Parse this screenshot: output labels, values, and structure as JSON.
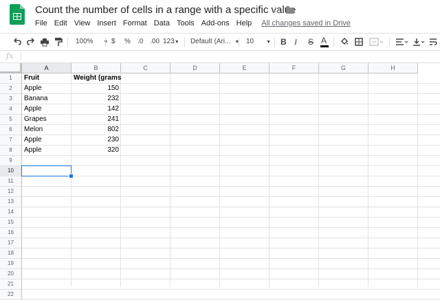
{
  "doc": {
    "title": "Count the number of cells in a range with a specific value",
    "saved_status": "All changes saved in Drive"
  },
  "menu": [
    "File",
    "Edit",
    "View",
    "Insert",
    "Format",
    "Data",
    "Tools",
    "Add-ons",
    "Help"
  ],
  "toolbar": {
    "zoom": "100%",
    "currency": "$",
    "percent": "%",
    "dec_decrease": ".0",
    "dec_increase": ".00",
    "more_formats": "123",
    "font": "Default (Ari...",
    "font_size": "10",
    "bold": "B",
    "italic": "I",
    "strike": "S",
    "text_color": "A"
  },
  "formula_bar": {
    "fx": "fx",
    "value": ""
  },
  "columns": [
    "A",
    "B",
    "C",
    "D",
    "E",
    "F",
    "G",
    "H"
  ],
  "rows": [
    "1",
    "2",
    "3",
    "4",
    "5",
    "6",
    "7",
    "8",
    "9",
    "10",
    "11",
    "12",
    "13",
    "14",
    "15",
    "16",
    "17",
    "18",
    "19",
    "20",
    "21",
    "22"
  ],
  "sheet": {
    "headers": [
      "Fruit",
      "Weight (grams)"
    ],
    "data": [
      [
        "Apple",
        "150"
      ],
      [
        "Banana",
        "232"
      ],
      [
        "Apple",
        "142"
      ],
      [
        "Grapes",
        "241"
      ],
      [
        "Melon",
        "802"
      ],
      [
        "Apple",
        "230"
      ],
      [
        "Apple",
        "320"
      ]
    ]
  },
  "selected_cell": "A10",
  "colors": {
    "selection": "#1a73e8",
    "logo": "#0f9d58"
  }
}
